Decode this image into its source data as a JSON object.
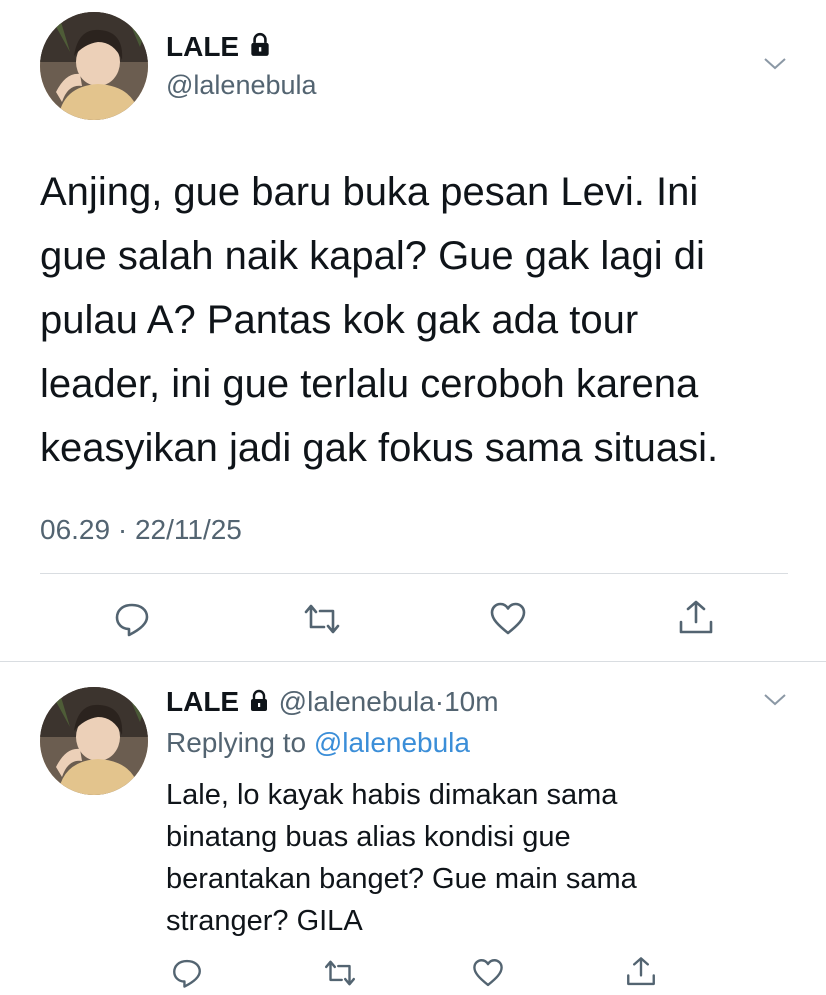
{
  "main_tweet": {
    "display_name": "LALE",
    "handle": "@lalenebula",
    "text_lines": [
      "Anjing, gue baru buka pesan Levi. Ini",
      "gue salah naik kapal? Gue gak lagi di",
      "pulau A? Pantas kok gak ada tour",
      "leader, ini gue terlalu ceroboh karena",
      "keasyikan jadi gak fokus sama situasi."
    ],
    "timestamp": "06.29 · 22/11/25",
    "actions": [
      "reply-icon",
      "retweet-icon",
      "like-icon",
      "share-icon"
    ]
  },
  "reply_tweet": {
    "display_name": "LALE",
    "handle": "@lalenebula",
    "time_ago": "10m",
    "replying_prefix": "Replying to",
    "replying_handle": "@lalenebula",
    "text_lines": [
      "Lale, lo kayak habis dimakan sama",
      "binatang buas alias kondisi gue",
      "berantakan banget? Gue main sama",
      "stranger? GILA"
    ],
    "actions": [
      "reply-icon",
      "retweet-icon",
      "like-icon",
      "share-icon"
    ]
  },
  "colors": {
    "text": "#0f1419",
    "secondary": "#536471",
    "link": "#3b8ed8",
    "divider": "#d9dde1"
  }
}
